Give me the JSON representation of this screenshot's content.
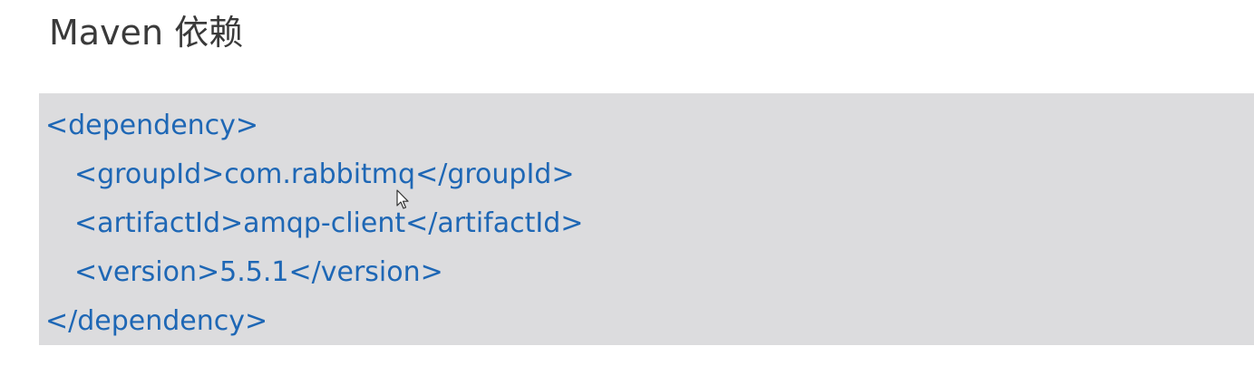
{
  "header": {
    "title": "Maven 依赖"
  },
  "code": {
    "lines": [
      {
        "indent": 0,
        "text": "<dependency>"
      },
      {
        "indent": 1,
        "text": "<groupId>com.rabbitmq</groupId>"
      },
      {
        "indent": 1,
        "text": "<artifactId>amqp-client</artifactId>"
      },
      {
        "indent": 1,
        "text": "<version>5.5.1</version>"
      },
      {
        "indent": 0,
        "text": "</dependency>"
      }
    ]
  },
  "colors": {
    "code_text": "#1e67b5",
    "code_background": "#dcdcde",
    "title_text": "#3a3a3a"
  },
  "icons": {
    "cursor": "mouse-pointer-icon"
  }
}
